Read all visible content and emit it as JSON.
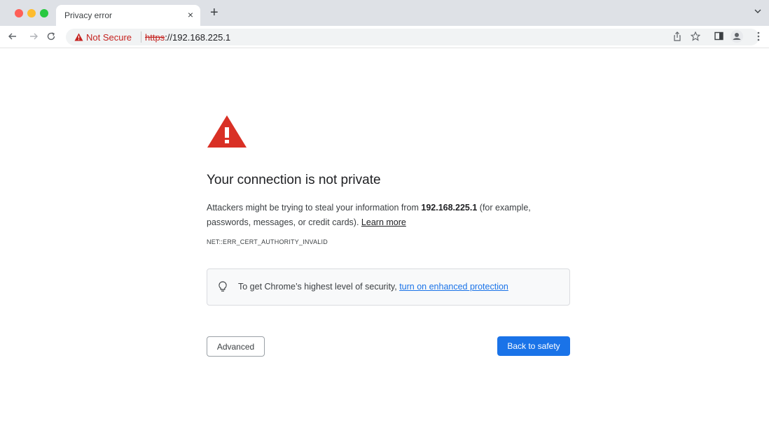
{
  "colors": {
    "tabstrip_bg": "#dee1e6",
    "warning_red": "#d93025",
    "not_secure_red": "#c5221f",
    "link_blue": "#1a73e8",
    "primary_button": "#1a73e8"
  },
  "window": {
    "controls": [
      "close",
      "minimize",
      "maximize"
    ]
  },
  "tab": {
    "title": "Privacy error",
    "close_glyph": "×",
    "new_tab_glyph": "+"
  },
  "toolbar": {
    "back_icon": "arrow-left-icon",
    "forward_icon": "arrow-right-icon",
    "reload_icon": "reload-icon",
    "security_label": "Not Secure",
    "url_scheme": "https",
    "url_rest": "://192.168.225.1",
    "right_icons": [
      "share-icon",
      "star-icon",
      "side-panel-icon",
      "profile-icon",
      "more-vert-icon"
    ]
  },
  "interstitial": {
    "icon": "warning-triangle-icon",
    "heading": "Your connection is not private",
    "body_before": "Attackers might be trying to steal your information from ",
    "body_host": "192.168.225.1",
    "body_after": " (for example, passwords, messages, or credit cards). ",
    "learn_more": "Learn more",
    "error_code": "NET::ERR_CERT_AUTHORITY_INVALID",
    "enhanced_prefix": "To get Chrome’s highest level of security, ",
    "enhanced_link": "turn on enhanced protection",
    "advanced_label": "Advanced",
    "back_to_safety_label": "Back to safety"
  }
}
